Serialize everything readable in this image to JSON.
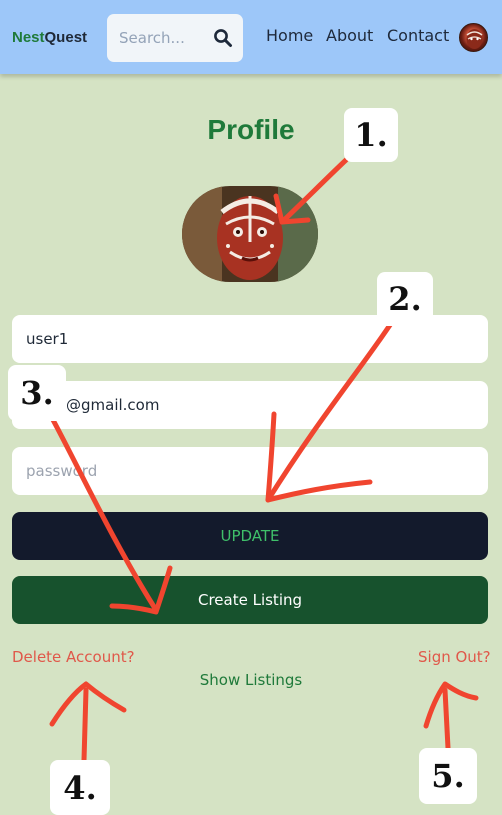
{
  "header": {
    "brand_part1": "Nest",
    "brand_part2": "Quest",
    "search_placeholder": "Search...",
    "nav": [
      "Home",
      "About",
      "Contact"
    ]
  },
  "profile": {
    "title": "Profile",
    "username_value": "user1",
    "email_value": "@gmail.com",
    "password_placeholder": "password",
    "update_label": "UPDATE",
    "create_listing_label": "Create Listing",
    "delete_account_label": "Delete Account?",
    "sign_out_label": "Sign Out?",
    "show_listings_label": "Show Listings"
  },
  "annotations": [
    "1.",
    "2.",
    "3.",
    "4.",
    "5."
  ],
  "colors": {
    "page_bg": "#d5e3c4",
    "header_bg": "#9dc7f9",
    "brand_green": "#1f7a3a",
    "update_bg": "#131a2c",
    "create_bg": "#17522d",
    "danger": "#e0584a",
    "arrow": "#f0452f"
  }
}
